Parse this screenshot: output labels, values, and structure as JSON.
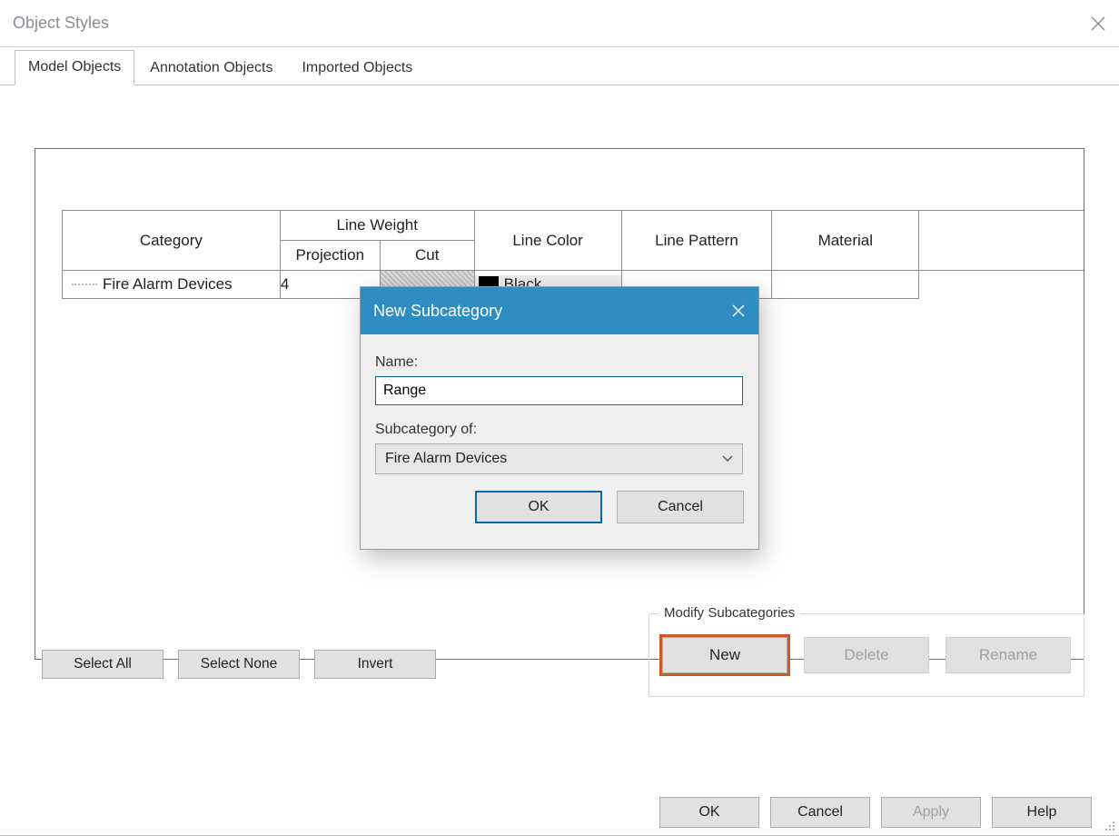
{
  "window": {
    "title": "Object Styles"
  },
  "tabs": {
    "model": "Model Objects",
    "annotation": "Annotation Objects",
    "imported": "Imported Objects"
  },
  "table": {
    "headers": {
      "category": "Category",
      "line_weight": "Line Weight",
      "projection": "Projection",
      "cut": "Cut",
      "line_color": "Line Color",
      "line_pattern": "Line Pattern",
      "material": "Material"
    },
    "rows": [
      {
        "category": "Fire Alarm Devices",
        "projection": "4",
        "line_color": "Black"
      }
    ]
  },
  "selection_buttons": {
    "select_all": "Select All",
    "select_none": "Select None",
    "invert": "Invert"
  },
  "modify_group": {
    "title": "Modify Subcategories",
    "new": "New",
    "delete": "Delete",
    "rename": "Rename"
  },
  "dialog_buttons": {
    "ok": "OK",
    "cancel": "Cancel",
    "apply": "Apply",
    "help": "Help"
  },
  "modal": {
    "title": "New Subcategory",
    "name_label": "Name:",
    "name_value": "Range",
    "subcat_label": "Subcategory of:",
    "subcat_value": "Fire Alarm Devices",
    "ok": "OK",
    "cancel": "Cancel"
  }
}
